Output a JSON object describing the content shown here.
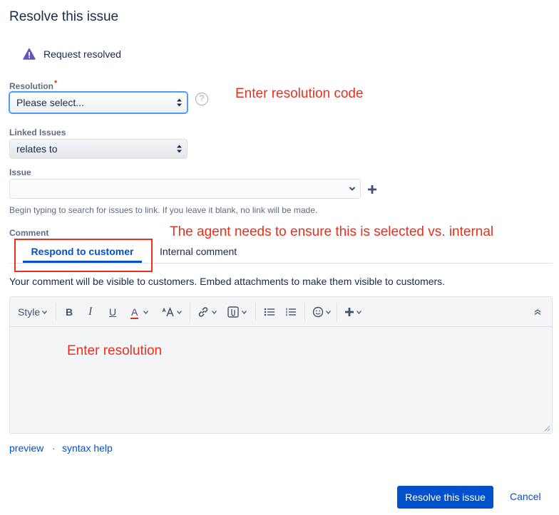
{
  "dialog": {
    "title": "Resolve this issue"
  },
  "status": {
    "text": "Request resolved",
    "icon": "warning-triangle-icon",
    "icon_color": "#6554c0"
  },
  "resolution": {
    "label": "Resolution",
    "required_mark": "*",
    "value": "Please select..."
  },
  "linked_issues": {
    "label": "Linked Issues",
    "value": "relates to"
  },
  "issue": {
    "label": "Issue",
    "value": "",
    "helper": "Begin typing to search for issues to link. If you leave it blank, no link will be made."
  },
  "comment": {
    "label": "Comment",
    "tabs": [
      {
        "label": "Respond to customer",
        "active": true
      },
      {
        "label": "Internal comment",
        "active": false
      }
    ],
    "visibility_note": "Your comment will be visible to customers. Embed attachments to make them visible to customers."
  },
  "toolbar": {
    "style_label": "Style",
    "bold": "B",
    "italic": "I",
    "underline": "U",
    "text_color": "A",
    "text_color_bar": "#de350b"
  },
  "links": {
    "preview": "preview",
    "separator": "·",
    "syntax_help": "syntax help"
  },
  "annotations": {
    "resolution_code": "Enter resolution code",
    "tab_note": "The agent needs to ensure this is selected vs. internal",
    "resolution": "Enter resolution"
  },
  "actions": {
    "resolve": "Resolve this issue",
    "cancel": "Cancel"
  },
  "colors": {
    "accent": "#0052cc",
    "annotation": "#e8301c",
    "text": "#172b4d"
  }
}
